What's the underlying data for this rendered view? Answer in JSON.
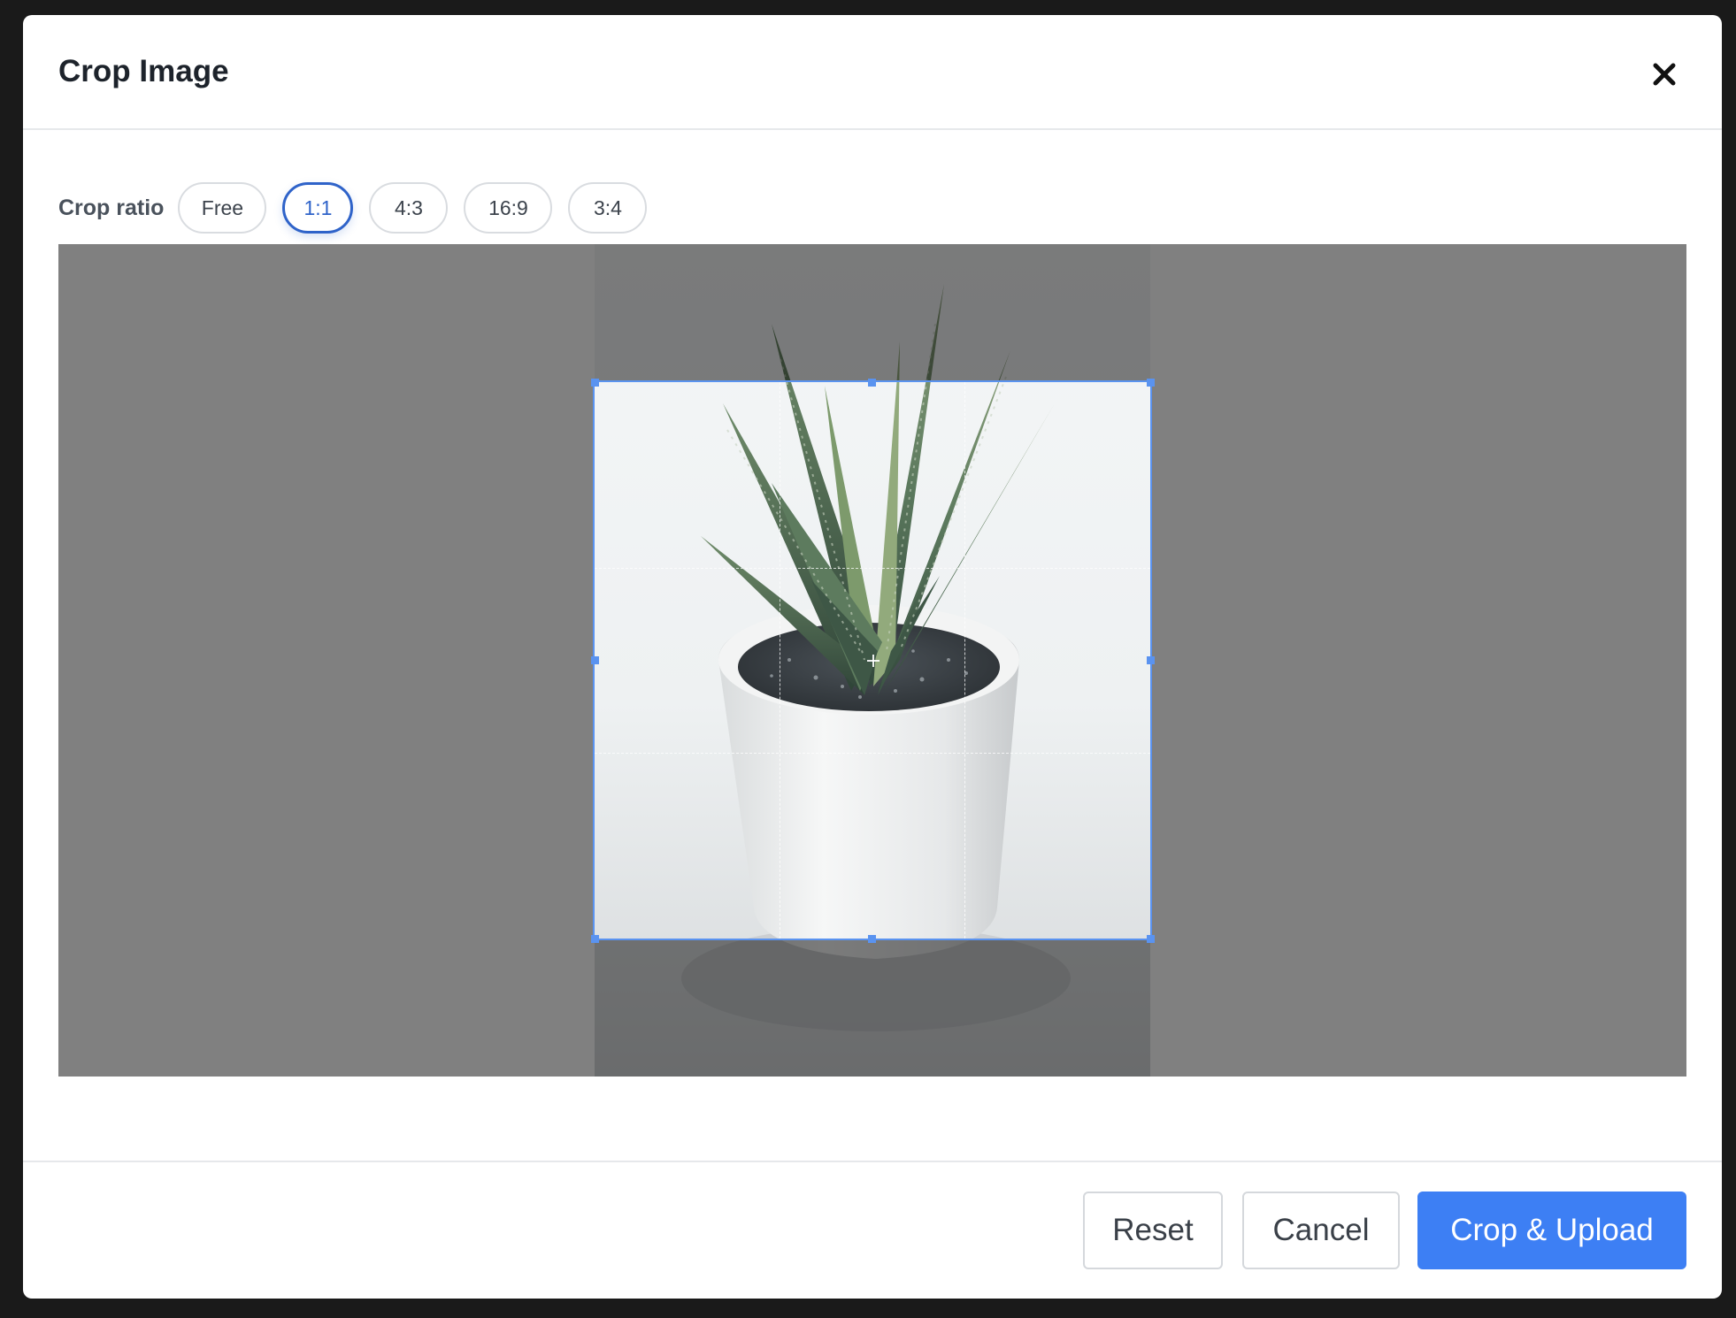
{
  "dialog": {
    "title": "Crop Image",
    "close_icon": "close-icon"
  },
  "crop_ratio": {
    "label": "Crop ratio",
    "options": [
      "Free",
      "1:1",
      "4:3",
      "16:9",
      "3:4"
    ],
    "selected": "1:1"
  },
  "editor": {
    "image_subject": "potted succulent plant in white pot",
    "overlay_color": "#808080",
    "crop_border_color": "#5a93f0",
    "center_icon": "crosshair-icon"
  },
  "footer": {
    "reset_label": "Reset",
    "cancel_label": "Cancel",
    "submit_label": "Crop & Upload"
  },
  "colors": {
    "accent": "#3d7ff4",
    "active_outline": "#2f63c9",
    "title_text": "#1d232b"
  }
}
